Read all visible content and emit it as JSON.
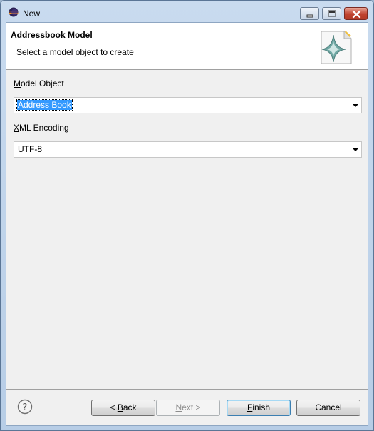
{
  "window": {
    "title": "New",
    "app_icon": "eclipse-icon",
    "controls": {
      "minimize_icon": "minimize-icon",
      "maximize_icon": "maximize-icon",
      "close_icon": "close-icon"
    }
  },
  "banner": {
    "title": "Addressbook Model",
    "description": "Select a model object to create",
    "icon": "wizard-banner-icon"
  },
  "form": {
    "model_object": {
      "label_mnemonic": "M",
      "label_rest": "odel Object",
      "value": "Address Book"
    },
    "xml_encoding": {
      "label_mnemonic": "X",
      "label_rest": "ML Encoding",
      "value": "UTF-8"
    }
  },
  "footer": {
    "help_icon": "help-icon",
    "back": {
      "prefix": "< ",
      "mnemonic": "B",
      "rest": "ack"
    },
    "next": {
      "mnemonic": "N",
      "rest": "ext >"
    },
    "finish": {
      "mnemonic": "F",
      "rest": "inish"
    },
    "cancel": {
      "label": "Cancel"
    }
  },
  "colors": {
    "selection": "#3399ff",
    "banner_background": "#ffffff",
    "dialog_background": "#f0f0f0"
  }
}
